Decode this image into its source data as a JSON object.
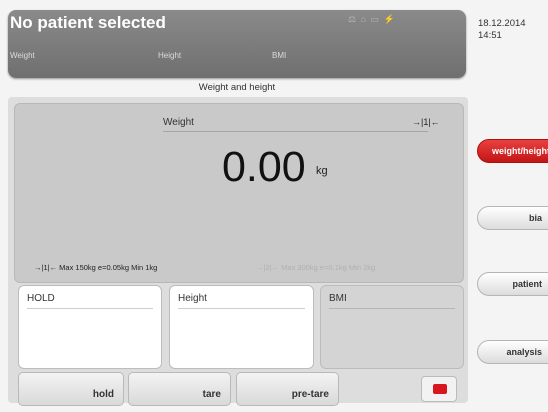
{
  "header": {
    "title": "No patient selected",
    "weight_label": "Weight",
    "height_label": "Height",
    "bmi_label": "BMI",
    "status_icons_text": "⚖ ⌂ ▭ ⚡"
  },
  "datetime": {
    "date": "18.12.2014",
    "time": "14:51"
  },
  "page_subtitle": "Weight and height",
  "weight_panel": {
    "label": "Weight",
    "value": "0.00",
    "unit": "kg",
    "range_indicator": "→|1|←",
    "range1": "→|1|←  Max 150kg e=0.05kg Min 1kg",
    "range2": "→|2|←  Max 300kg e=0.1kg Min 2kg"
  },
  "boxes": {
    "hold_label": "HOLD",
    "height_label": "Height",
    "bmi_label": "BMI"
  },
  "buttons": {
    "hold": "hold",
    "tare": "tare",
    "pretare": "pre-tare"
  },
  "side_tabs": [
    {
      "label": "weight/height",
      "active": true
    },
    {
      "label": "bia",
      "active": false
    },
    {
      "label": "patient",
      "active": false
    },
    {
      "label": "analysis",
      "active": false
    }
  ],
  "colors": {
    "accent": "#d8161f",
    "header": "#7d7d7d"
  }
}
